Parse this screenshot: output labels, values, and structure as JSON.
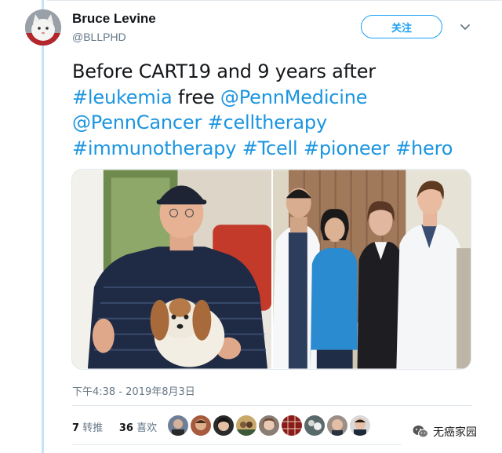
{
  "user": {
    "name": "Bruce Levine",
    "handle": "@BLLPHD"
  },
  "follow_label": "关注",
  "tweet": {
    "line1": "Before CART19 and 9 years after",
    "tag_leukemia": "#leukemia",
    "word_free": " free ",
    "mention_penn_medicine": "@PennMedicine",
    "mention_penn_cancer": "@PennCancer",
    "tag_celltherapy": "#celltherapy",
    "tag_immunotherapy": "#immunotherapy",
    "tag_tcell": "#Tcell",
    "tag_pioneer": "#pioneer",
    "tag_hero": "#hero"
  },
  "timestamp": "下午4:38 - 2019年8月3日",
  "stats": {
    "retweet_count": "7",
    "retweet_label": "转推",
    "like_count": "36",
    "like_label": "喜欢"
  },
  "liker_avatar_count": 9,
  "watermark": "无癌家园",
  "colors": {
    "accent": "#1da1f2",
    "link": "#1b95e0",
    "muted": "#657786",
    "thread_line": "#c5e3f6"
  },
  "icons": [
    "chevron-down-icon",
    "wechat-logo-icon"
  ]
}
